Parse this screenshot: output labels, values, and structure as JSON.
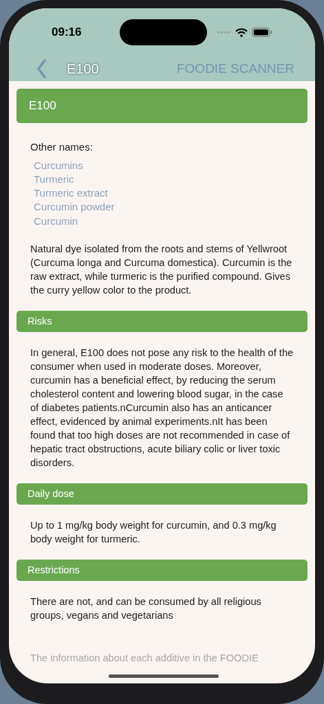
{
  "status_bar": {
    "time": "09:16"
  },
  "nav": {
    "title": "E100",
    "app_name": "FOODIE SCANNER"
  },
  "additive": {
    "title": "E100",
    "other_names_label": "Other names:",
    "other_names": [
      "Curcumins",
      "Turmeric",
      "Turmeric extract",
      "Curcumin powder",
      "Curcumin"
    ],
    "description": "Natural dye isolated from the roots and stems of Yellwroot (Curcuma longa and Curcuma domestica). Curcumin is the raw extract, while turmeric is the purified compound. Gives the curry yellow color to the product."
  },
  "sections": [
    {
      "title": "Risks",
      "text": "In general, E100 does not pose any risk to the health of the consumer when used in moderate doses. Moreover, curcumin has a beneficial effect, by reducing the serum cholesterol content and lowering blood sugar, in the case of diabetes patients.nCurcumin also has an anticancer effect, evidenced by animal experiments.nIt has been found that too high doses are not recommended in case of hepatic tract obstructions, acute biliary colic or liver toxic disorders."
    },
    {
      "title": "Daily dose",
      "text": "Up to 1 mg/kg body weight for curcumin, and 0.3 mg/kg body weight for turmeric."
    },
    {
      "title": "Restrictions",
      "text": "There are not, and can be consumed by all religious groups, vegans and vegetarians"
    }
  ],
  "footer_note": "The information about each additive in the FOODIE"
}
